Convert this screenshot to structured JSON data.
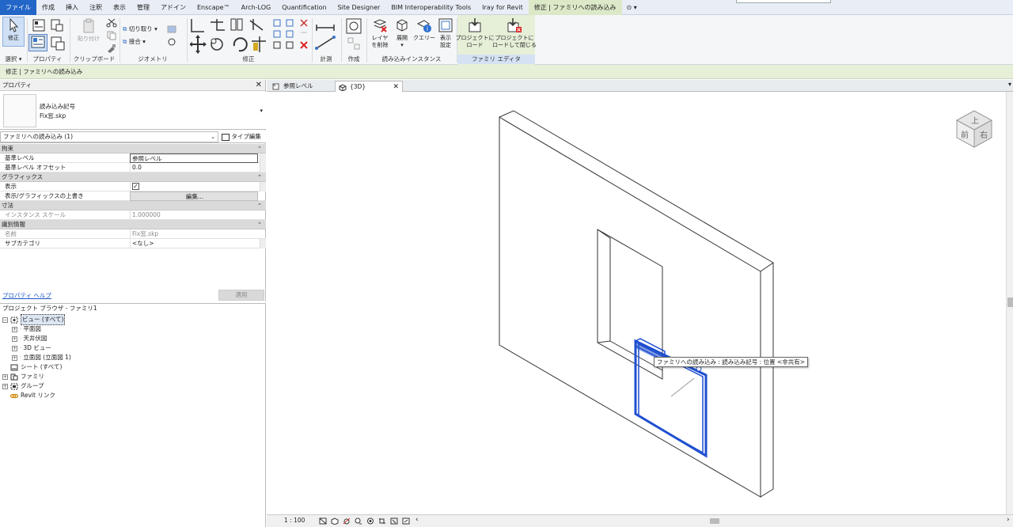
{
  "menu": {
    "tabs": [
      "ファイル",
      "作成",
      "挿入",
      "注釈",
      "表示",
      "管理",
      "アドイン",
      "Enscape™",
      "Arch-LOG",
      "Quantification",
      "Site Designer",
      "BIM Interoperability Tools",
      "Iray for Revit",
      "修正 | ファミリへの読み込み"
    ],
    "extra": "⊙ ▾"
  },
  "ribbon": {
    "modify_label": "修正",
    "paste_label": "貼り付け",
    "cut_label": "切り取り",
    "join_label": "接合",
    "groups": {
      "select": "選択",
      "properties": "プロパティ",
      "clipboard": "クリップボード",
      "geometry": "ジオメトリ",
      "modify": "修正",
      "measure": "計測",
      "create": "作成",
      "import_instance": "読み込みインスタンス",
      "family_editor": "ファミリ エディタ"
    },
    "buttons": {
      "delete_layers": "レイヤ\nを削除",
      "explode": "展開",
      "query": "クエリー",
      "display_settings": "表示\n設定",
      "load_to_project": "プロジェクトに\nロード",
      "load_close": "プロジェクトに\nロードして閉じる"
    }
  },
  "options_bar": {
    "text": "修正 | ファミリへの読み込み"
  },
  "properties": {
    "title": "プロパティ",
    "type_name": "読み込み記号",
    "type_file": "Fix窓.skp",
    "instance_selector": "ファミリへの読み込み (1)",
    "type_edit": "タイプ編集",
    "categories": [
      {
        "name": "拘束",
        "rows": [
          {
            "key": "基準レベル",
            "value": "参照レベル",
            "style": "boxed"
          },
          {
            "key": "基準レベル オフセット",
            "value": "0.0",
            "style": ""
          }
        ]
      },
      {
        "name": "グラフィックス",
        "rows": [
          {
            "key": "表示",
            "value": "☑",
            "style": "check"
          },
          {
            "key": "表示/グラフィックスの上書き",
            "value": "編集...",
            "style": "btn"
          }
        ]
      },
      {
        "name": "寸法",
        "rows": [
          {
            "key": "インスタンス スケール",
            "value": "1.000000",
            "style": "gray"
          }
        ]
      },
      {
        "name": "識別情報",
        "rows": [
          {
            "key": "名前",
            "value": "Fix窓.skp",
            "style": "gray"
          },
          {
            "key": "サブカテゴリ",
            "value": "<なし>",
            "style": ""
          }
        ]
      }
    ],
    "help_link": "プロパティ ヘルプ",
    "apply_button": "適用"
  },
  "browser": {
    "title": "プロジェクト ブラウザ - ファミリ1",
    "nodes": {
      "views": "ビュー (すべて)",
      "floor_plan": "平面図",
      "ceiling_plan": "天井伏図",
      "view_3d": "3D ビュー",
      "elevations": "立面図 (立面図 1)",
      "sheets": "シート (すべて)",
      "families": "ファミリ",
      "groups": "グループ",
      "revit_links": "Revit リンク"
    }
  },
  "view_tabs": [
    {
      "label": "参照レベル",
      "close": ""
    },
    {
      "label": "{3D}",
      "close": "✕"
    }
  ],
  "view": {
    "tooltip": "ファミリへの読み込み : 読み込み記号 : 位置 <非共有>",
    "viewcube_top": "上",
    "viewcube_front": "前",
    "viewcube_right": "右",
    "scale": "1 : 100",
    "selection_color": "#1f4fd0"
  }
}
